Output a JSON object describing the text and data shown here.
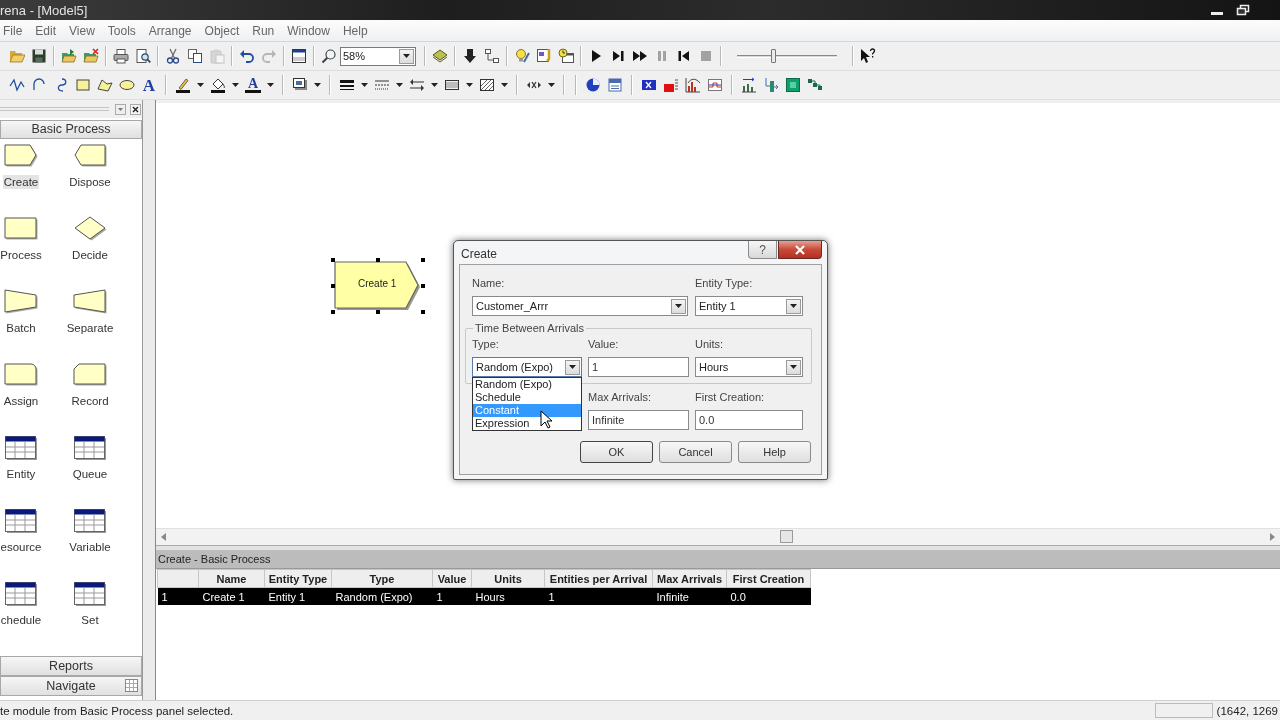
{
  "window": {
    "title": "rena - [Model5]"
  },
  "menu": [
    "File",
    "Edit",
    "View",
    "Tools",
    "Arrange",
    "Object",
    "Run",
    "Window",
    "Help"
  ],
  "standard_toolbar": {
    "buttons": [
      {
        "disabled": false
      },
      {
        "disabled": false
      },
      {
        "disabled": false
      },
      {
        "disabled": false
      },
      {
        "disabled": false
      },
      {
        "disabled": false
      },
      {
        "disabled": false
      },
      {
        "disabled": false
      },
      {
        "disabled": true
      },
      {
        "disabled": false
      },
      {
        "disabled": true
      },
      {
        "disabled": false
      },
      {
        "disabled": false
      },
      {
        "disabled": false
      },
      {
        "disabled": false
      },
      {
        "disabled": false
      },
      {
        "disabled": false
      },
      {
        "disabled": false
      },
      {
        "disabled": false
      },
      {
        "disabled": false
      },
      {
        "disabled": false
      },
      {
        "disabled": false
      },
      {
        "disabled": true
      },
      {
        "disabled": false
      },
      {
        "disabled": true
      },
      {
        "disabled": false
      }
    ],
    "zoom": "58%",
    "speed_slider": {
      "level": 0.36
    }
  },
  "drawing_toolbar": {
    "text_tool": "A",
    "font_color": "A"
  },
  "project_bar": {
    "panel": "Basic Process",
    "modules": [
      {
        "label": "Create",
        "kind": "create",
        "selected": true
      },
      {
        "label": "Dispose",
        "kind": "dispose",
        "selected": false
      },
      {
        "label": "Process",
        "kind": "process",
        "selected": false
      },
      {
        "label": "Decide",
        "kind": "decide",
        "selected": false
      },
      {
        "label": "Batch",
        "kind": "batch",
        "selected": false
      },
      {
        "label": "Separate",
        "kind": "separate",
        "selected": false
      },
      {
        "label": "Assign",
        "kind": "assign",
        "selected": false
      },
      {
        "label": "Record",
        "kind": "record",
        "selected": false
      },
      {
        "label": "Entity",
        "kind": "data",
        "selected": false
      },
      {
        "label": "Queue",
        "kind": "data",
        "selected": false
      },
      {
        "label": "esource",
        "kind": "data",
        "selected": false
      },
      {
        "label": "Variable",
        "kind": "data",
        "selected": false
      },
      {
        "label": "chedule",
        "kind": "data",
        "selected": false
      },
      {
        "label": "Set",
        "kind": "data",
        "selected": false
      }
    ],
    "footer_panels": [
      "Reports",
      "Navigate"
    ]
  },
  "canvas": {
    "module": {
      "label": "Create 1",
      "selected": true
    }
  },
  "dialog": {
    "title": "Create",
    "help_button": "?",
    "fields": [
      {
        "label": "Name:",
        "value": "Customer_Arrr",
        "kind": "combo",
        "expanded": false
      },
      {
        "label": "Entity Type:",
        "value": "Entity 1",
        "kind": "combo",
        "expanded": false
      }
    ],
    "group": {
      "title": "Time Between Arrivals",
      "fields": [
        {
          "label": "Type:",
          "value": "Random (Expo)",
          "kind": "combo",
          "expanded": true
        },
        {
          "label": "Value:",
          "value": "1",
          "kind": "text"
        },
        {
          "label": "Units:",
          "value": "Hours",
          "kind": "combo",
          "expanded": false
        }
      ]
    },
    "lower_fields": [
      {
        "label": "Max Arrivals:",
        "value": "Infinite",
        "kind": "text"
      },
      {
        "label": "First Creation:",
        "value": "0.0",
        "kind": "text"
      }
    ],
    "dropdown": [
      {
        "label": "Random (Expo)",
        "selected": false
      },
      {
        "label": "Schedule",
        "selected": false
      },
      {
        "label": "Constant",
        "selected": true
      },
      {
        "label": "Expression",
        "selected": false
      }
    ],
    "buttons": [
      "OK",
      "Cancel",
      "Help"
    ]
  },
  "spreadsheet": {
    "title": "Create - Basic Process",
    "columns": [
      "Name",
      "Entity Type",
      "Type",
      "Value",
      "Units",
      "Entities per Arrival",
      "Max Arrivals",
      "First Creation"
    ],
    "rows": [
      {
        "number": "1",
        "cells": [
          "Create 1",
          "Entity 1",
          "Random (Expo)",
          "1",
          "Hours",
          "1",
          "Infinite",
          "0.0"
        ],
        "selected": true
      }
    ]
  },
  "status_bar": {
    "message": "te module from Basic Process panel selected.",
    "coordinates": "(1642, 1269"
  }
}
